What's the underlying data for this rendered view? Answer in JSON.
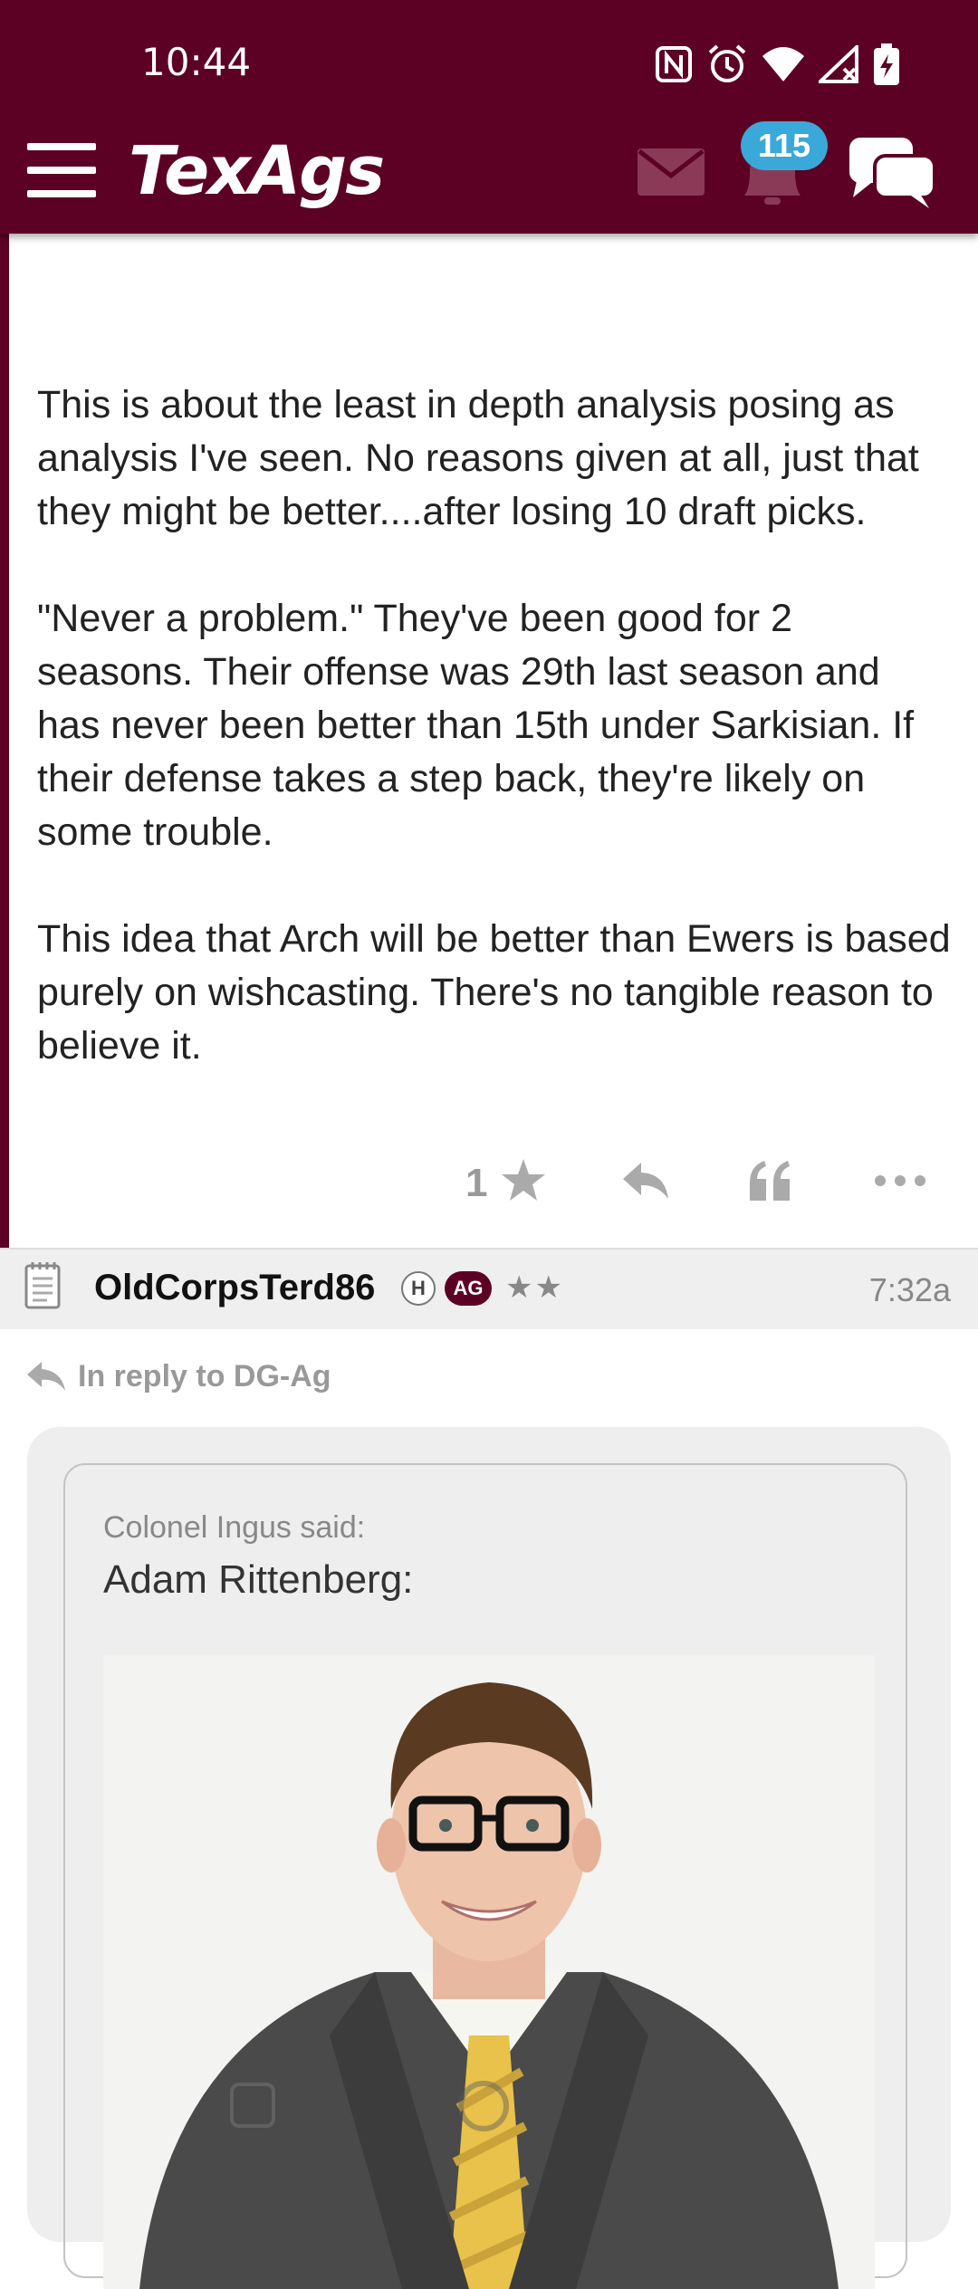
{
  "status_bar": {
    "time": "10:44",
    "icons": [
      "nfc-icon",
      "alarm-icon",
      "wifi-icon",
      "signal-off-icon",
      "battery-charging-icon"
    ]
  },
  "header": {
    "logo": "TexAgs",
    "notification_count": "115",
    "colors": {
      "header_bg": "#5c0024",
      "badge_bg": "#3aa8d8"
    }
  },
  "post1": {
    "paragraphs": [
      "This is about the least in depth analysis posing as analysis I've seen. No reasons given at all, just that they might be better....after losing 10 draft picks.",
      "\"Never a problem.\" They've been good for 2 seasons. Their offense was 29th last season and has never been better than 15th under Sarkisian. If their defense takes a step back, they're likely on some trouble.",
      "This idea that Arch will be better than Ewers is based purely on wishcasting. There's no tangible reason to believe it."
    ],
    "star_count": "1"
  },
  "post2": {
    "username": "OldCorpsTerd86",
    "badge_h": "H",
    "badge_ag": "AG",
    "rank_stars": "★★",
    "time": "7:32a",
    "reply_to": "In reply to DG-Ag",
    "quote": {
      "said": "Colonel Ingus said:",
      "author": "Adam Rittenberg:"
    }
  }
}
